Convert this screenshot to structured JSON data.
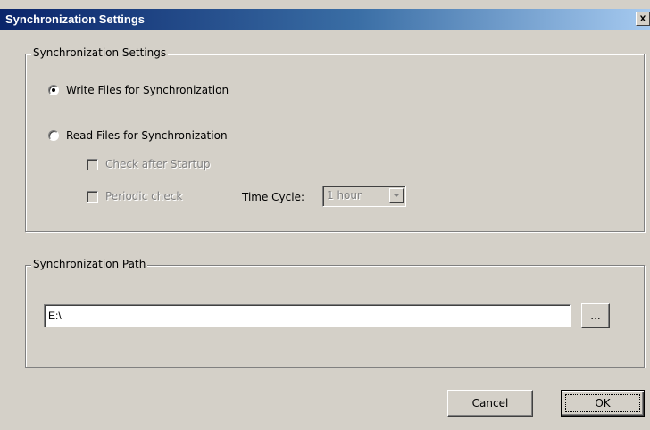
{
  "window": {
    "title": "Synchronization Settings",
    "close_glyph": "x"
  },
  "sync_group": {
    "title": "Synchronization Settings",
    "write_option": {
      "label": "Write Files for Synchronization",
      "selected": true
    },
    "read_option": {
      "label": "Read Files for Synchronization",
      "selected": false
    },
    "check_startup": {
      "label": "Check after Startup",
      "checked": false,
      "enabled": false
    },
    "periodic_check": {
      "label": "Periodic check",
      "checked": false,
      "enabled": false
    },
    "time_cycle": {
      "label": "Time Cycle:",
      "value": "1 hour",
      "enabled": false
    }
  },
  "path_group": {
    "title": "Synchronization Path",
    "path_value": "E:\\",
    "browse_label": "..."
  },
  "buttons": {
    "cancel_label": "Cancel",
    "ok_label": "OK"
  },
  "icons": {
    "close": "close-icon",
    "dropdown": "chevron-down-icon"
  },
  "colors": {
    "dialog_bg": "#d4d0c8",
    "title_start": "#0a246a",
    "title_end": "#a6caf0"
  }
}
